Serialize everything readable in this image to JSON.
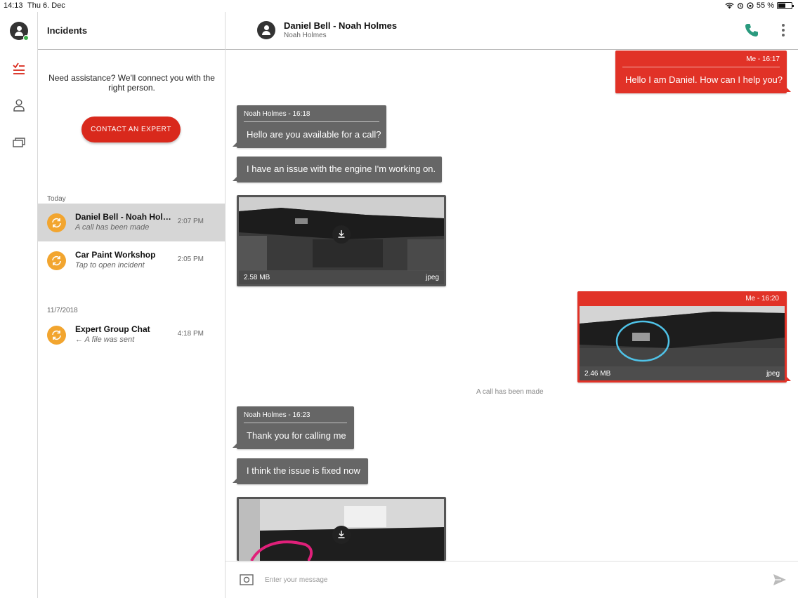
{
  "status_bar": {
    "time": "14:13",
    "date": "Thu 6. Dec",
    "battery": "55 %"
  },
  "rail": {
    "icons": [
      "incidents-icon",
      "contacts-icon",
      "gallery-icon"
    ]
  },
  "incidents_panel": {
    "title": "Incidents",
    "assist_text": "Need assistance? We'll connect you with the right person.",
    "contact_button": "CONTACT AN EXPERT",
    "sections": [
      {
        "label": "Today",
        "items": [
          {
            "title": "Daniel Bell - Noah Holmes",
            "subtitle": "A call has been made",
            "time": "2:07 PM"
          },
          {
            "title": "Car Paint Workshop",
            "subtitle": "Tap to open incident",
            "time": "2:05 PM"
          }
        ]
      },
      {
        "label": "11/7/2018",
        "items": [
          {
            "title": "Expert Group Chat",
            "subtitle": "← A file was sent",
            "time": "4:18 PM"
          }
        ]
      }
    ]
  },
  "chat": {
    "title": "Daniel Bell - Noah Holmes",
    "subtitle": "Noah Holmes",
    "messages": [
      {
        "meta": "Me - 16:17",
        "text": "Hello I am Daniel. How can I help you?"
      },
      {
        "meta": "Noah Holmes - 16:18",
        "text": "Hello are you available for a call?"
      },
      {
        "text": "I have an issue with the engine I'm working on."
      },
      {
        "size": "2.58 MB",
        "ext": "jpeg"
      },
      {
        "meta": "Me - 16:20",
        "size": "2.46 MB",
        "ext": "jpeg"
      },
      {
        "system": "A call has been made"
      },
      {
        "meta": "Noah Holmes - 16:23",
        "text": "Thank you for calling me"
      },
      {
        "text": "I think the issue is fixed now"
      }
    ],
    "composer_placeholder": "Enter your message"
  },
  "colors": {
    "accent": "#d9291c",
    "incident_icon": "#f2a52f",
    "phone": "#2a9a7e",
    "incoming_bubble": "#666666"
  }
}
